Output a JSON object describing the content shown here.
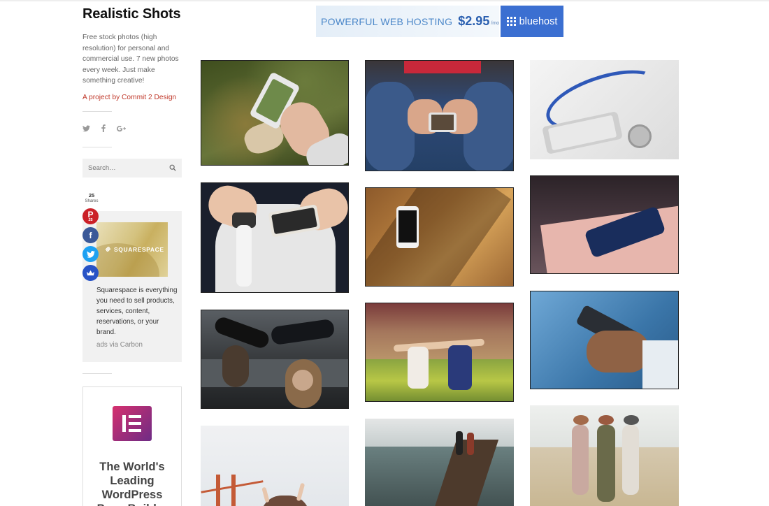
{
  "site": {
    "title": "Realistic Shots",
    "description": "Free stock photos (high resolution) for personal and commercial use. 7 new photos every week. Just make something creative!",
    "project_link": "A project by Commit 2 Design"
  },
  "social": {
    "twitter_icon": "twitter-icon",
    "facebook_icon": "facebook-icon",
    "googleplus_icon": "google-plus-icon"
  },
  "search": {
    "placeholder": "Search…"
  },
  "share": {
    "count": "25",
    "count_label": "Shares",
    "pinterest_count": "25",
    "buttons": [
      "pinterest-icon",
      "facebook-icon",
      "twitter-icon",
      "sumo-icon"
    ]
  },
  "carbon_ad": {
    "brand": "SQUARESPACE",
    "text": "Squarespace is everything you need to sell products, services, content, reservations, or your brand.",
    "via": "ads via Carbon"
  },
  "elementor_ad": {
    "text": "The World's Leading WordPress Page Builder"
  },
  "banner": {
    "headline": "POWERFUL WEB HOSTING",
    "price": "$2.95",
    "per": "/mo",
    "brand": "bluehost"
  },
  "gallery": {
    "photos": [
      {
        "alt": "phone-in-hand-on-grass"
      },
      {
        "alt": "person-holding-phone-on-lap"
      },
      {
        "alt": "stethoscope-and-phone"
      },
      {
        "alt": "hands-with-smartwatch-and-phone"
      },
      {
        "alt": "phone-on-wooden-table"
      },
      {
        "alt": "dark-phone-on-pink-book"
      },
      {
        "alt": "people-lying-on-car"
      },
      {
        "alt": "dancers-in-field"
      },
      {
        "alt": "hand-holding-phone-blue"
      },
      {
        "alt": "bridge-with-raised-hands"
      },
      {
        "alt": "couple-on-railway-bridge"
      },
      {
        "alt": "three-women-on-beach"
      }
    ]
  }
}
